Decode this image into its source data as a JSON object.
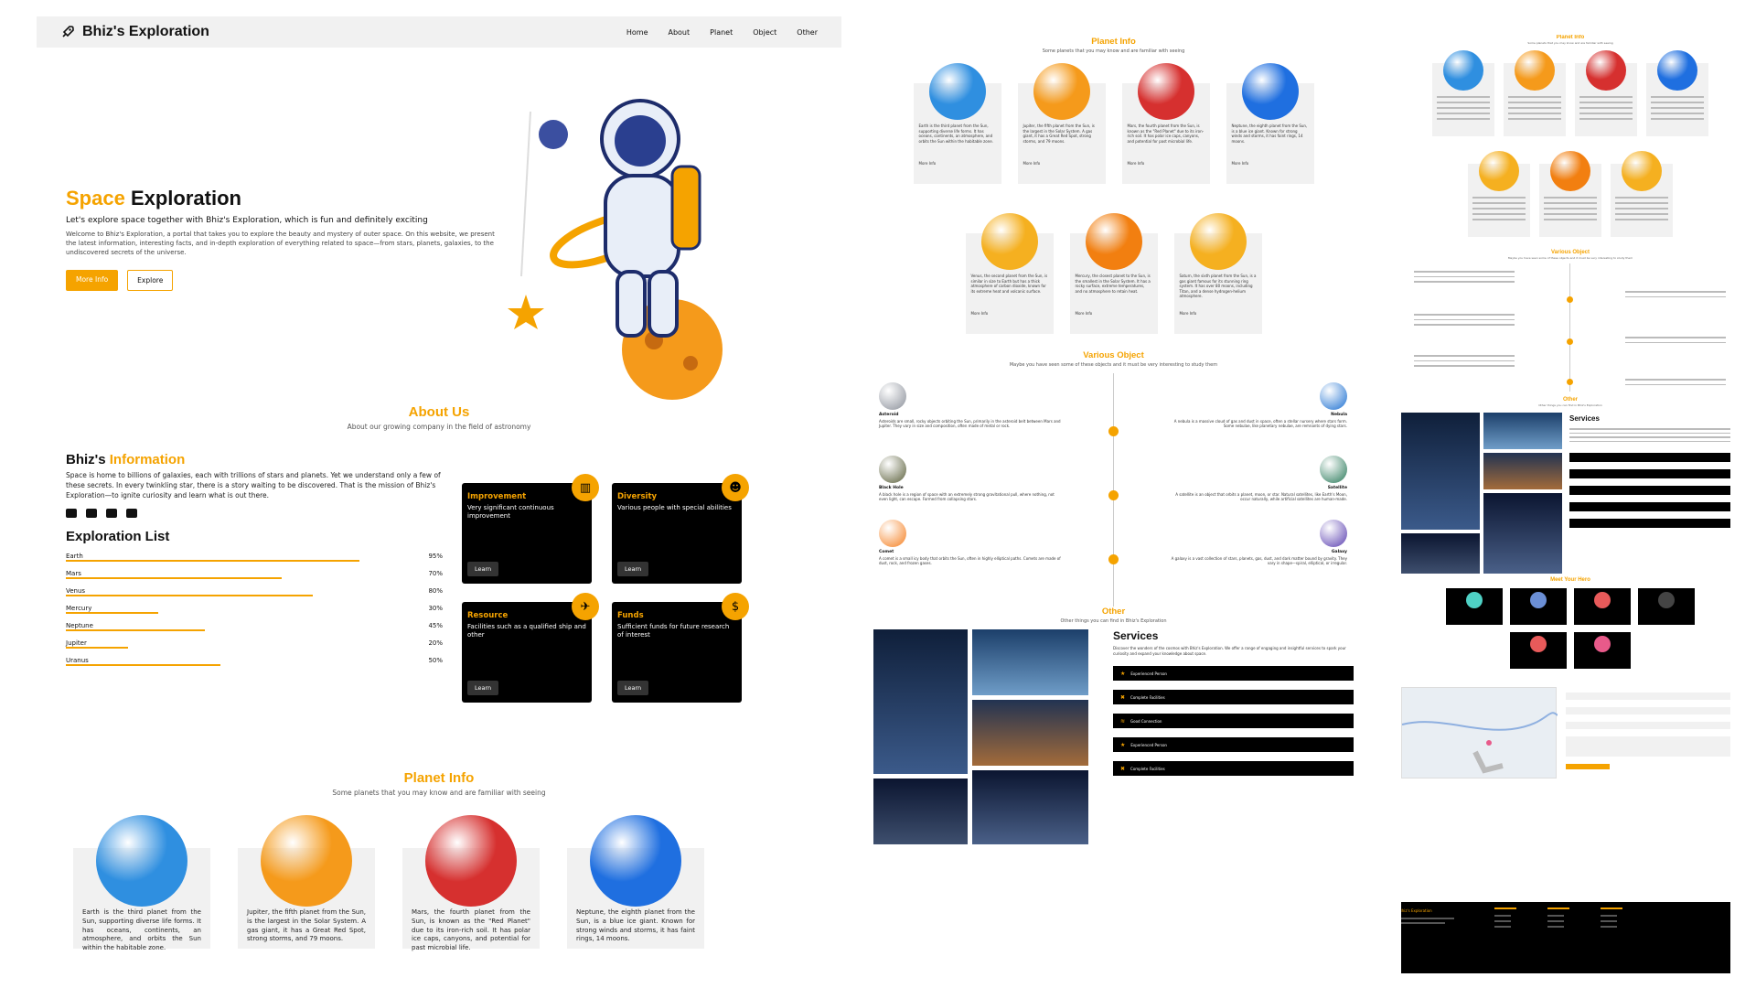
{
  "brand": {
    "name": "Bhiz's Exploration",
    "icon": "rocket-icon"
  },
  "nav": [
    "Home",
    "About",
    "Planet",
    "Object",
    "Other"
  ],
  "hero": {
    "title_highlight": "Space",
    "title_rest": " Exploration",
    "subtitle": "Let's explore space together with Bhiz's Exploration, which is fun and definitely exciting",
    "description": "Welcome to Bhiz's Exploration, a portal that takes you to explore the beauty and mystery of outer space. On this website, we present the latest information, interesting facts, and in-depth exploration of everything related to space—from stars, planets, galaxies, to the undiscovered secrets of the universe.",
    "btn_primary": "More Info",
    "btn_secondary": "Explore"
  },
  "about": {
    "title": "About Us",
    "subtitle": "About our growing company in the field of astronomy",
    "heading_a": "Bhiz's ",
    "heading_b": "Information",
    "description": "Space is home to billions of galaxies, each with trillions of stars and planets. Yet we understand only a few of these secrets. In every twinkling star, there is a story waiting to be discovered. That is the mission of Bhiz's Exploration—to ignite curiosity and learn what is out there."
  },
  "exploration": {
    "title": "Exploration List",
    "items": [
      {
        "label": "Earth",
        "pct": 95,
        "text": "95%"
      },
      {
        "label": "Mars",
        "pct": 70,
        "text": "70%"
      },
      {
        "label": "Venus",
        "pct": 80,
        "text": "80%"
      },
      {
        "label": "Mercury",
        "pct": 30,
        "text": "30%"
      },
      {
        "label": "Neptune",
        "pct": 45,
        "text": "45%"
      },
      {
        "label": "Jupiter",
        "pct": 20,
        "text": "20%"
      },
      {
        "label": "Uranus",
        "pct": 50,
        "text": "50%"
      }
    ]
  },
  "cards": [
    {
      "title": "Improvement",
      "desc": "Very significant continuous improvement",
      "btn": "Learn",
      "icon": "chart-icon",
      "glyph": "▥"
    },
    {
      "title": "Diversity",
      "desc": "Various people with special abilities",
      "btn": "Learn",
      "icon": "people-icon",
      "glyph": "☻"
    },
    {
      "title": "Resource",
      "desc": "Facilities such as a qualified ship and other",
      "btn": "Learn",
      "icon": "plane-icon",
      "glyph": "✈"
    },
    {
      "title": "Funds",
      "desc": "Sufficient funds for future research of interest",
      "btn": "Learn",
      "icon": "dollar-icon",
      "glyph": "$"
    }
  ],
  "planet_info": {
    "title": "Planet Info",
    "subtitle": "Some planets that you may know and are familiar with seeing",
    "more": "More Info",
    "planets": [
      {
        "name": "Earth",
        "desc": "Earth is the third planet from the Sun, supporting diverse life forms. It has oceans, continents, an atmosphere, and orbits the Sun within the habitable zone.",
        "color": "#2f8fe0"
      },
      {
        "name": "Jupiter",
        "desc": "Jupiter, the fifth planet from the Sun, is the largest in the Solar System. A gas giant, it has a Great Red Spot, strong storms, and 79 moons.",
        "color": "#f59a1b"
      },
      {
        "name": "Mars",
        "desc": "Mars, the fourth planet from the Sun, is known as the \"Red Planet\" due to its iron-rich soil. It has polar ice caps, canyons, and potential for past microbial life.",
        "color": "#d6302f"
      },
      {
        "name": "Neptune",
        "desc": "Neptune, the eighth planet from the Sun, is a blue ice giant. Known for strong winds and storms, it has faint rings, 14 moons.",
        "color": "#1f6fe0"
      },
      {
        "name": "Venus",
        "desc": "Venus, the second planet from the Sun, is similar in size to Earth but has a thick atmosphere of carbon dioxide, known for its extreme heat and volcanic surface.",
        "color": "#f5b020"
      },
      {
        "name": "Mercury",
        "desc": "Mercury, the closest planet to the Sun, is the smallest in the Solar System. It has a rocky surface, extreme temperatures, and no atmosphere to retain heat.",
        "color": "#f27f10"
      },
      {
        "name": "Saturn",
        "desc": "Saturn, the sixth planet from the Sun, is a gas giant famous for its stunning ring system. It has over 80 moons, including Titan, and a dense hydrogen-helium atmosphere.",
        "color": "#f5b020"
      }
    ]
  },
  "objects": {
    "title": "Various Object",
    "subtitle": "Maybe you have seen some of these objects and it must be very interesting to study them",
    "items": [
      {
        "name": "Asteroid",
        "side": "left",
        "desc": "Asteroids are small, rocky objects orbiting the Sun, primarily in the asteroid belt between Mars and Jupiter. They vary in size and composition, often made of metal or rock.",
        "color": "#8a8f99"
      },
      {
        "name": "Nebula",
        "side": "right",
        "desc": "A nebula is a massive cloud of gas and dust in space, often a stellar nursery where stars form. Some nebulae, like planetary nebulae, are remnants of dying stars.",
        "color": "#1b6fd1"
      },
      {
        "name": "Black Hole",
        "side": "left",
        "desc": "A black hole is a region of space with an extremely strong gravitational pull, where nothing, not even light, can escape. Formed from collapsing stars.",
        "color": "#5a5f3a"
      },
      {
        "name": "Satellite",
        "side": "right",
        "desc": "A satellite is an object that orbits a planet, moon, or star. Natural satellites, like Earth's Moon, occur naturally, while artificial satellites are human-made.",
        "color": "#2a7a5a"
      },
      {
        "name": "Comet",
        "side": "left",
        "desc": "A comet is a small icy body that orbits the Sun, often in highly elliptical paths. Comets are made of dust, rock, and frozen gases.",
        "color": "#f57f20"
      },
      {
        "name": "Galaxy",
        "side": "right",
        "desc": "A galaxy is a vast collection of stars, planets, gas, dust, and dark matter bound by gravity. They vary in shape—spiral, elliptical, or irregular.",
        "color": "#5a3fb0"
      }
    ]
  },
  "other": {
    "title": "Other",
    "subtitle": "Other things you can find in Bhiz's Exploration",
    "services_title": "Services",
    "services_desc": "Discover the wonders of the cosmos with Bhiz's Exploration. We offer a range of engaging and insightful services to spark your curiosity and expand your knowledge about space.",
    "services": [
      {
        "label": "Experienced Person",
        "glyph": "★"
      },
      {
        "label": "Complete Facilities",
        "glyph": "✖"
      },
      {
        "label": "Good Connection",
        "glyph": "≋"
      },
      {
        "label": "Experienced Person",
        "glyph": "★"
      },
      {
        "label": "Complete Facilities",
        "glyph": "✖"
      }
    ],
    "next_title": "Meet Your Hero"
  },
  "colors": {
    "accent": "#f5a300",
    "card_bg": "#000000",
    "panel_bg": "#f1f1f1"
  }
}
